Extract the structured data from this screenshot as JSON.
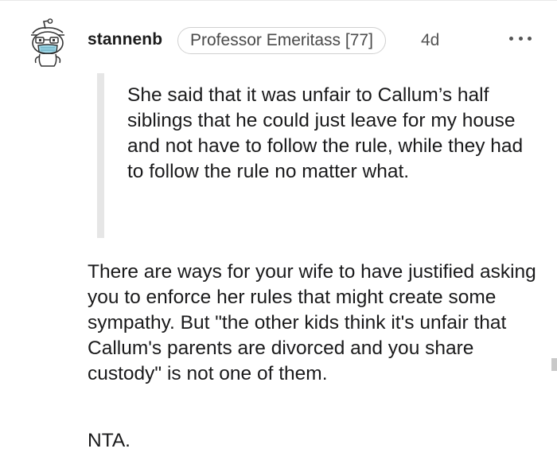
{
  "comment": {
    "username": "stannenb",
    "flair": "Professor Emeritass [77]",
    "age": "4d",
    "quote": "She said that it was unfair to Callum’s half siblings that he could just leave for my house and not have to follow the rule, while they had to follow the rule no matter what.",
    "body": "There are ways for your wife to have justified asking you to enforce her rules that might create some sympathy. But \"the other kids think it's unfair that Callum's parents are divorced and you share custody\" is not one of them.",
    "verdict": "NTA."
  },
  "icons": {
    "avatar": "snoo-avatar-icon",
    "more": "more-options-icon"
  }
}
